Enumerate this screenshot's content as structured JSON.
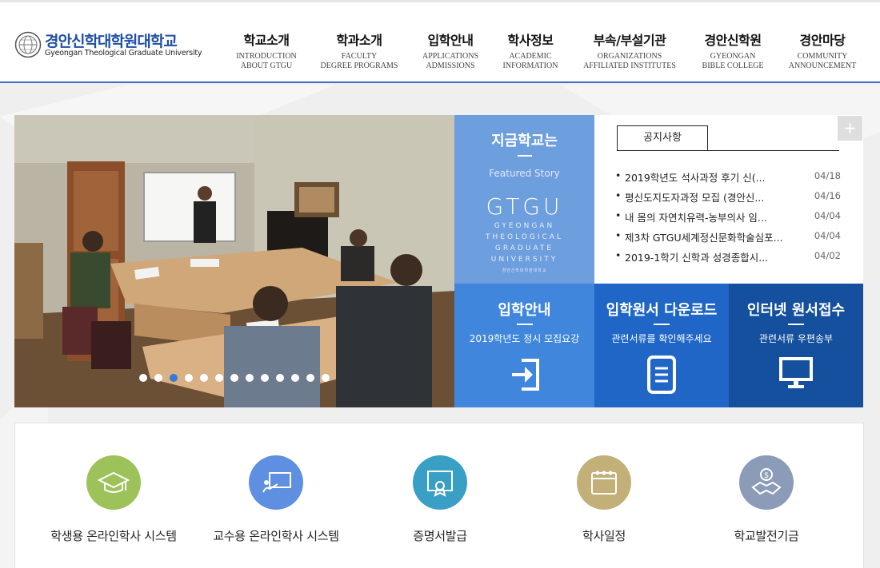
{
  "logo": {
    "name_ko": "경안신학대학원대학교",
    "name_en": "Gyeongan Theological Graduate University"
  },
  "nav": [
    {
      "ko": "학교소개",
      "en1": "INTRODUCTION",
      "en2": "ABOUT GTGU"
    },
    {
      "ko": "학과소개",
      "en1": "FACULTY",
      "en2": "DEGREE PROGRAMS"
    },
    {
      "ko": "입학안내",
      "en1": "APPLICATIONS",
      "en2": "ADMISSIONS"
    },
    {
      "ko": "학사정보",
      "en1": "ACADEMIC",
      "en2": "INFORMATION"
    },
    {
      "ko": "부속/부설기관",
      "en1": "ORGANIZATIONS",
      "en2": "AFFILIATED INSTITUTES"
    },
    {
      "ko": "경안신학원",
      "en1": "GYEONGAN",
      "en2": "BIBLE COLLEGE"
    },
    {
      "ko": "경안마당",
      "en1": "COMMUNITY",
      "en2": "ANNOUNCEMENT"
    }
  ],
  "slider": {
    "dot_count": 13,
    "active_index": 2
  },
  "featured": {
    "title": "지금학교는",
    "subtitle": "Featured Story",
    "logo_text": "GTGU",
    "logo_lines": [
      "GYEONGAN",
      "THEOLOGICAL",
      "GRADUATE",
      "UNIVERSITY"
    ],
    "tiny_text": "경안신학대학원대학교"
  },
  "notice": {
    "tab_label": "공지사항",
    "more_label": "+",
    "items": [
      {
        "title": "2019학년도 석사과정 후기 신(...",
        "date": "04/18"
      },
      {
        "title": "평신도지도자과정 모집 (경안신...",
        "date": "04/16"
      },
      {
        "title": "내 몸의 자연치유력-농부의사 임...",
        "date": "04/04"
      },
      {
        "title": "제3차 GTGU세계정신문화학술심포...",
        "date": "04/04"
      },
      {
        "title": "2019-1학기 신학과 성경종합시...",
        "date": "04/02"
      }
    ]
  },
  "quick_boxes": [
    {
      "title": "입학안내",
      "sub": "2019학년도 정시 모집요강",
      "icon": "login-arrow-icon",
      "color": "#3f86dc"
    },
    {
      "title": "입학원서 다운로드",
      "sub": "관련서류를 확인해주세요",
      "icon": "document-icon",
      "color": "#1f66c6"
    },
    {
      "title": "인터넷 원서접수",
      "sub": "관련서류 우편송부",
      "icon": "monitor-icon",
      "color": "#14509d"
    }
  ],
  "quick_menu": [
    {
      "label": "학생용 온라인학사 시스템",
      "icon": "graduation-cap-icon",
      "color": "#9ec25a"
    },
    {
      "label": "교수용 온라인학사 시스템",
      "icon": "teacher-board-icon",
      "color": "#5f8fe0"
    },
    {
      "label": "증명서발급",
      "icon": "certificate-icon",
      "color": "#3a9fc4"
    },
    {
      "label": "학사일정",
      "icon": "calendar-icon",
      "color": "#c3b079"
    },
    {
      "label": "학교발전기금",
      "icon": "handshake-dollar-icon",
      "color": "#8b9bb8"
    }
  ]
}
